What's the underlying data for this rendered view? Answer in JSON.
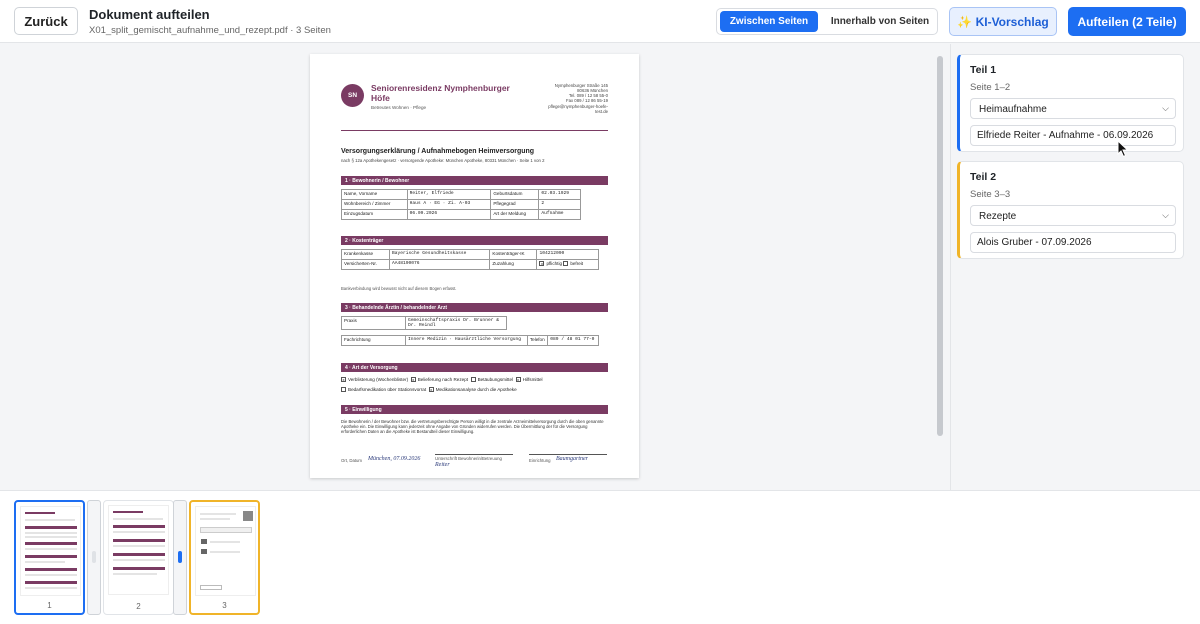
{
  "toolbar": {
    "back_label": "Zurück",
    "title": "Dokument aufteilen",
    "subtitle": "X01_split_gemischt_aufnahme_und_rezept.pdf · 3 Seiten",
    "mode_between": "Zwischen Seiten",
    "mode_within": "Innerhalb von Seiten",
    "ai_label": "✨ KI-Vorschlag",
    "split_label": "Aufteilen (2 Teile)"
  },
  "doc": {
    "logo": "SN",
    "org_line1": "Seniorenresidenz Nymphenburger",
    "org_line2": "Höfe",
    "org_sub": "Betreutes Wohnen · Pflege",
    "addr1": "Nymphenburger Straße 145",
    "addr2": "80636 München",
    "addr3": "Tel. 089 / 12 58 55-0",
    "addr4": "Fax 089 / 12 86 55-19",
    "addr5": "pflege@nymphenburger-hoefe-",
    "addr6": "test.de",
    "heading": "Versorgungserklärung / Aufnahmebogen Heimversorgung",
    "heading_sub": "nach § 12a Apothekengesetz · versorgende Apotheke: München Apotheke, 80331 München · Seite 1 von 2",
    "s1": "1 · Bewohnerin / Bewohner",
    "s1_r1": [
      "Name, Vorname",
      "Reiter, Elfriede",
      "Geburtsdatum",
      "02.03.1929"
    ],
    "s1_r2": [
      "Wohnbereich / Zimmer",
      "Haus A · EG · Zi. A-03",
      "Pflegegrad",
      "2"
    ],
    "s1_r3": [
      "Einzugsdatum",
      "06.09.2026",
      "Art der Meldung",
      "Aufnahme"
    ],
    "s2": "2 · Kostenträger",
    "s2_r1": [
      "Krankenkasse",
      "Bayerische Gesundheitskasse",
      "Kostenträger-IK",
      "104212090"
    ],
    "s2_r2": [
      "Versicherten-Nr.",
      "AA48190076",
      "Zuzahlung",
      "pflichtig",
      "befreit"
    ],
    "s2_note": "Bankverbindung wird bewusst nicht auf diesem Bogen erfasst.",
    "s3": "3 · Behandelnde Ärztin / behandelnder Arzt",
    "s3_r1": [
      "Praxis",
      "Gemeinschaftspraxis Dr. Brunner & Dr. Reindl"
    ],
    "s3_r2": [
      "Fachrichtung",
      "Innere Medizin · Hausärztliche Versorgung",
      "Telefon",
      "089 / 48 01 77-0"
    ],
    "s4": "4 · Art der Versorgung",
    "s4_opts": [
      "Verblisterung (Wochenblister)",
      "Belieferung nach Rezept",
      "Betäubungsmittel",
      "Hilfsmittel",
      "Bedarfsmedikation über Stationsvorrat",
      "Medikationsanalyse durch die Apotheke"
    ],
    "s5": "5 · Einwilligung",
    "s5_text": "Die Bewohnerin / der Bewohner bzw. die vertretungsberechtigte Person willigt in die zentrale Arzneimittelversorgung durch die oben genannte Apotheke ein. Die Einwilligung kann jederzeit ohne Angabe von Gründen widerrufen werden. Die Übermittlung der für die Versorgung erforderlichen Daten an die Apotheke ist Bestandteil dieser Einwilligung.",
    "sig_place_label": "Ort, Datum",
    "sig_place": "München, 07.09.2026",
    "sig_resident_label": "Unterschrift Bewohnerin/Betreuung",
    "sig_resident": "Reiter",
    "sig_facility_label": "Einrichtung",
    "sig_facility": "Baumgartner"
  },
  "parts": [
    {
      "title": "Teil 1",
      "pages": "Seite 1–2",
      "type": "Heimaufnahme",
      "name": "Elfriede Reiter - Aufnahme - 06.09.2026"
    },
    {
      "title": "Teil 2",
      "pages": "Seite 3–3",
      "type": "Rezepte",
      "name": "Alois Gruber - 07.09.2026"
    }
  ],
  "thumbs": [
    "1",
    "2",
    "3"
  ],
  "colors": {
    "accent": "#1d6ef2",
    "part2": "#f0b429",
    "brand": "#7a3b63"
  }
}
